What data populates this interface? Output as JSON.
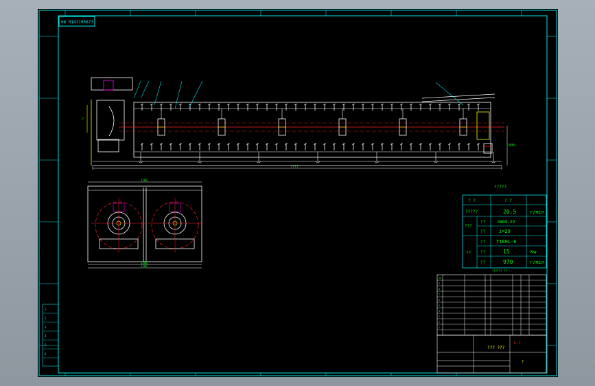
{
  "colors": {
    "background": "#000000",
    "frame": "#00e5e5",
    "white_lines": "#ffffff",
    "red_lines": "#ff2020",
    "green_text": "#00ff00",
    "yellow": "#ffff00",
    "magenta": "#ff00ff"
  },
  "drawing": {
    "code_box": "08 0141195673",
    "unknown_label": "?????",
    "dim_total": "????",
    "dim_end": "600",
    "front_dims": {
      "top": "2200",
      "bottom_a": "1300",
      "bottom_b": "2300"
    }
  },
  "spec_table": {
    "header": [
      "? ?",
      "? ?"
    ],
    "rows": [
      {
        "name": "?????",
        "value": "20.5",
        "unit": "r/min"
      },
      {
        "group": "???",
        "name": "??",
        "value": "XWD9-29",
        "unit": ""
      },
      {
        "group": "???",
        "name": "??",
        "value": "i=29",
        "unit": ""
      },
      {
        "group": "??",
        "name": "??",
        "value": "Y180L-6",
        "unit": ""
      },
      {
        "group": "??",
        "name": "??",
        "value": "15",
        "unit": "Kw"
      },
      {
        "group": "??",
        "name": "??",
        "value": "970",
        "unit": "r/min"
      }
    ],
    "note": "??????  ??"
  },
  "title_block": {
    "drawing_name": "??? ???",
    "scale": "1:?"
  },
  "left_table_rows": [
    "1",
    "2",
    "3",
    "4",
    "5",
    "6"
  ]
}
